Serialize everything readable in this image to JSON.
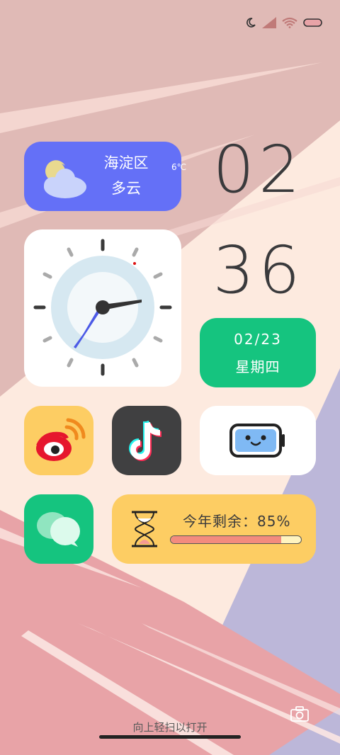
{
  "status_bar": {
    "icons": [
      "moon-icon",
      "signal-icon",
      "wifi-icon",
      "battery-icon"
    ]
  },
  "weather": {
    "location": "海淀区",
    "condition": "多云",
    "temperature": "6℃",
    "icon": "partly-cloudy-icon",
    "background": "#6470f7"
  },
  "time": {
    "hour": "02",
    "minute": "36"
  },
  "date_widget": {
    "date": "02/23",
    "weekday": "星期四",
    "background": "#15c47f"
  },
  "apps": [
    {
      "name": "weibo-icon",
      "background": "#fdcd63"
    },
    {
      "name": "tiktok-icon",
      "background": "#404041"
    },
    {
      "name": "wechat-icon",
      "background": "#15c47f"
    }
  ],
  "battery_widget": {
    "icon": "battery-face-icon"
  },
  "year_progress": {
    "label": "今年剩余：85%",
    "progress": 0.85,
    "fill_color": "#f38b7e"
  },
  "lock": {
    "unlock_hint": "向上轻扫以打开",
    "camera_icon": "camera-icon"
  }
}
